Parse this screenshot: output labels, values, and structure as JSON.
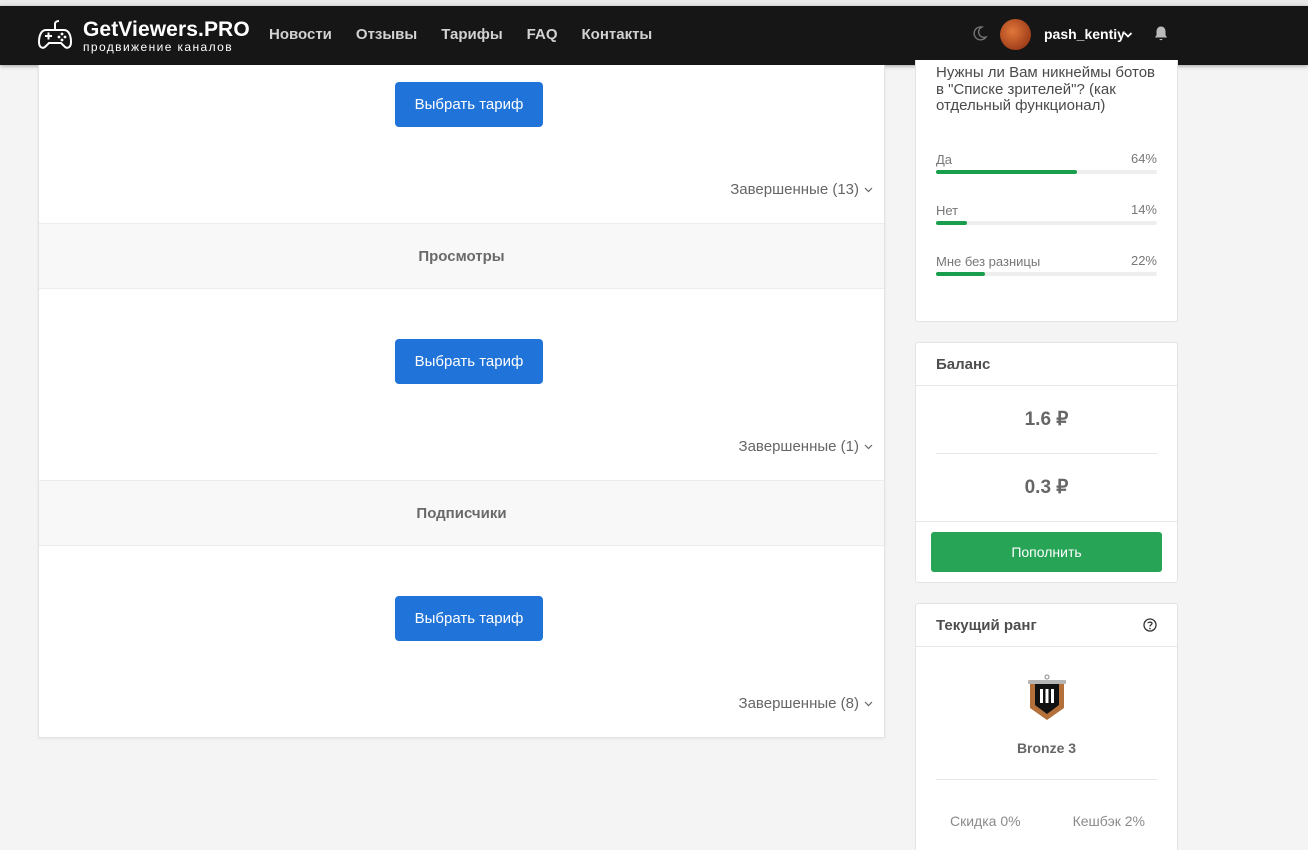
{
  "navbar": {
    "brand_title": "GetViewers.PRO",
    "brand_subtitle": "продвижение каналов",
    "links": [
      "Новости",
      "Отзывы",
      "Тарифы",
      "FAQ",
      "Контакты"
    ],
    "username": "pash_kentiy"
  },
  "main": {
    "select_tariff_label": "Выбрать тариф",
    "sections": [
      {
        "completed": "Завершенные (13)"
      },
      {
        "title": "Просмотры",
        "completed": "Завершенные (1)"
      },
      {
        "title": "Подписчики",
        "completed": "Завершенные (8)"
      }
    ]
  },
  "poll": {
    "question": "Нужны ли Вам никнеймы ботов в \"Списке зрителей\"? (как отдельный функционал)",
    "options": [
      {
        "label": "Да",
        "percent_text": "64%",
        "percent": 64
      },
      {
        "label": "Нет",
        "percent_text": "14%",
        "percent": 14
      },
      {
        "label": "Мне без разницы",
        "percent_text": "22%",
        "percent": 22
      }
    ]
  },
  "balance": {
    "title": "Баланс",
    "value_1": "1.6 ₽",
    "value_2": "0.3 ₽",
    "topup_label": "Пополнить"
  },
  "rank": {
    "title": "Текущий ранг",
    "name": "Bronze 3",
    "discount": "Скидка 0%",
    "cashback": "Кешбэк 2%"
  },
  "colors": {
    "navbar_bg": "#161616",
    "primary_blue": "#2073d8",
    "success_green": "#27a456",
    "poll_bar": "#189e4c"
  }
}
